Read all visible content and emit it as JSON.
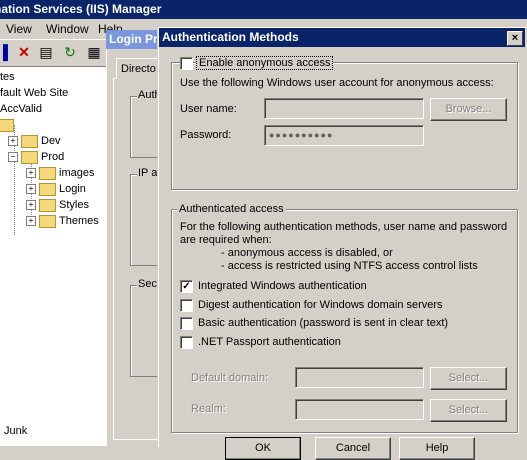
{
  "iis": {
    "title": "rmation Services (IIS) Manager",
    "menu": {
      "view": "View",
      "window": "Window",
      "help": "Help"
    },
    "tree": {
      "root": "tes",
      "default_site": "fault Web Site",
      "accvalid": "AccValid",
      "dev": "Dev",
      "prod": "Prod",
      "images": "images",
      "login": "Login",
      "styles": "Styles",
      "themes": "Themes",
      "junk": "Junk"
    }
  },
  "props": {
    "title": "Login Pr",
    "tab": "Directo",
    "group1": "Auth",
    "group2": "IP a",
    "group3": "Secu"
  },
  "dialog": {
    "title": "Authentication Methods",
    "close": "×",
    "anon": {
      "checkbox_label": "Enable anonymous access",
      "checked": false,
      "description": "Use the following Windows user account for anonymous access:",
      "username_label": "User name:",
      "username_value": "",
      "password_label": "Password:",
      "password_value": "●●●●●●●●●●",
      "browse": "Browse..."
    },
    "auth": {
      "legend": "Authenticated access",
      "desc1": "For the following authentication methods, user name and password",
      "desc2": "are required when:",
      "bullet1": "- anonymous access is disabled, or",
      "bullet2": "- access is restricted using NTFS access control lists",
      "integrated": "Integrated Windows authentication",
      "integrated_checked": true,
      "digest": "Digest authentication for Windows domain servers",
      "digest_checked": false,
      "basic": "Basic authentication (password is sent in clear text)",
      "basic_checked": false,
      "passport": ".NET Passport authentication",
      "passport_checked": false,
      "default_domain_label": "Default domain:",
      "realm_label": "Realm:",
      "select1": "Select...",
      "select2": "Select..."
    },
    "buttons": {
      "ok": "OK",
      "cancel": "Cancel",
      "help": "Help"
    }
  },
  "colors": {
    "title_active": "#0a246a",
    "face": "#d4d0c8"
  }
}
